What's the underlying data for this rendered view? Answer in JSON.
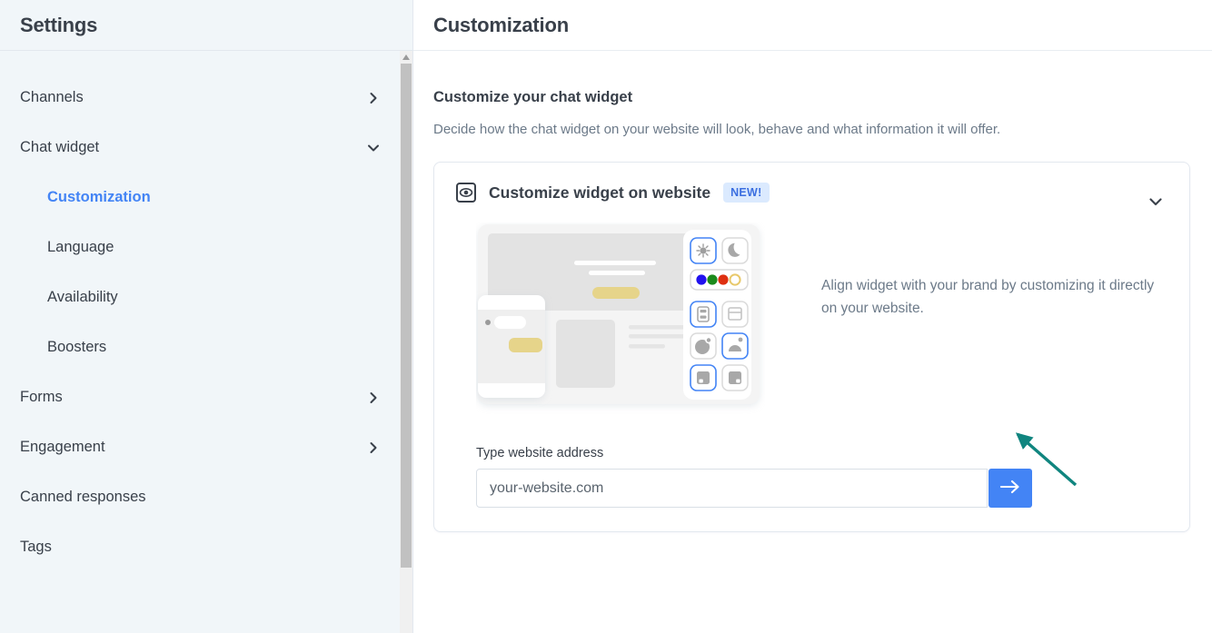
{
  "sidebar": {
    "title": "Settings",
    "items": [
      {
        "label": "Channels",
        "icon": "chevron-right-icon",
        "level": 0,
        "active": false
      },
      {
        "label": "Chat widget",
        "icon": "chevron-down-icon",
        "level": 0,
        "active": false
      },
      {
        "label": "Customization",
        "icon": "",
        "level": 1,
        "active": true
      },
      {
        "label": "Language",
        "icon": "",
        "level": 1,
        "active": false
      },
      {
        "label": "Availability",
        "icon": "",
        "level": 1,
        "active": false
      },
      {
        "label": "Boosters",
        "icon": "",
        "level": 1,
        "active": false
      },
      {
        "label": "Forms",
        "icon": "chevron-right-icon",
        "level": 0,
        "active": false
      },
      {
        "label": "Engagement",
        "icon": "chevron-right-icon",
        "level": 0,
        "active": false
      },
      {
        "label": "Canned responses",
        "icon": "",
        "level": 0,
        "active": false
      },
      {
        "label": "Tags",
        "icon": "",
        "level": 0,
        "active": false
      }
    ]
  },
  "header": {
    "title": "Customization"
  },
  "main": {
    "section_title": "Customize your chat widget",
    "section_subtitle": "Decide how the chat widget on your website will look, behave and what information it will offer.",
    "card": {
      "icon": "eye-preview-icon",
      "title": "Customize widget on website",
      "badge": "NEW!",
      "collapse_icon": "chevron-down-icon",
      "description": "Align widget with your brand by customizing it directly on your website.",
      "form": {
        "label": "Type website address",
        "input_value": "",
        "input_placeholder": "your-website.com",
        "submit_icon": "arrow-right-icon"
      }
    }
  },
  "colors": {
    "accent": "#4384f5",
    "sidebar_bg": "#f1f6f9",
    "text": "#39404a",
    "muted_text": "#6c7a89",
    "badge_bg": "#dbeafe",
    "badge_text": "#3b6fe0",
    "annotation_arrow": "#10857f",
    "illustration_yellow": "#e6d48a",
    "swatch_blue": "#2111ee",
    "swatch_green": "#1b8a1b",
    "swatch_red": "#de2f10",
    "swatch_gold": "#e8c86a"
  }
}
